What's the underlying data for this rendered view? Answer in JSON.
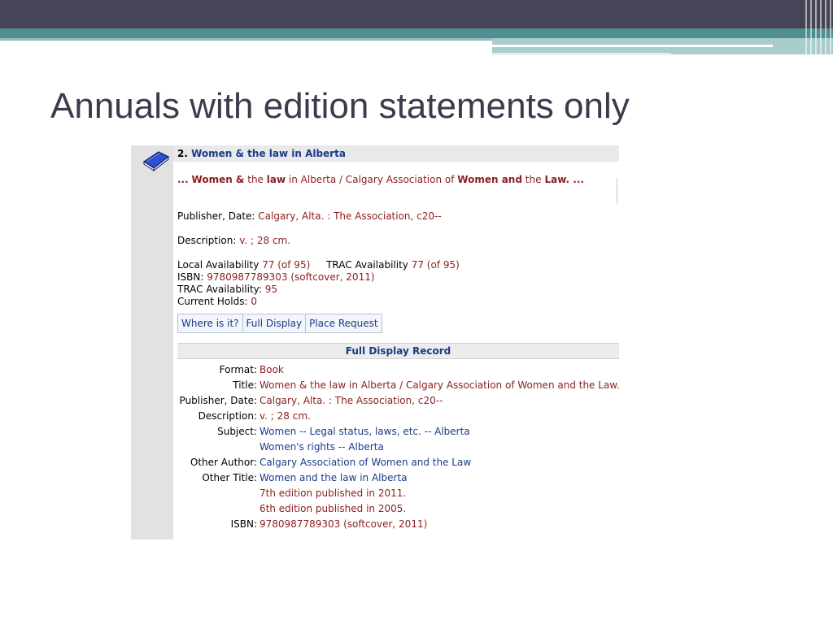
{
  "slide": {
    "title": "Annuals with edition statements only"
  },
  "record": {
    "number": "2.",
    "title": "Women & the law in Alberta",
    "summary": {
      "ellipsis1": "...",
      "w1": "Women &",
      "w2": "the",
      "w3": "law",
      "w4": "in Alberta / Calgary Association of",
      "w5": "Women and",
      "w6": "the",
      "w7": "Law",
      "w8": ". ..."
    },
    "publisher_label": "Publisher, Date:",
    "publisher_value": "Calgary, Alta. : The Association, c20--",
    "description_label": "Description:",
    "description_value": "v. ; 28 cm.",
    "local_avail_label": "Local Availability",
    "local_avail_value": "77 (of 95)",
    "trac_avail_label": "TRAC Availability",
    "trac_avail_value": "77 (of 95)",
    "isbn_label": "ISBN:",
    "isbn_value": "9780987789303 (softcover, 2011)",
    "trac_avail2_label": "TRAC Availability:",
    "trac_avail2_value": "95",
    "holds_label": "Current Holds:",
    "holds_value": "0"
  },
  "buttons": {
    "where": "Where is it?",
    "full": "Full Display",
    "place": "Place Request"
  },
  "full_display": {
    "header": "Full Display Record",
    "format_label": "Format:",
    "format_value": "Book",
    "title_label": "Title:",
    "title_value": "Women & the law in Alberta / Calgary Association of Women and the Law.",
    "publisher_label": "Publisher, Date:",
    "publisher_value": "Calgary, Alta. : The Association, c20--",
    "description_label": "Description:",
    "description_value": "v. ; 28 cm.",
    "subject_label": "Subject:",
    "subject_value1": "Women -- Legal status, laws, etc. -- Alberta",
    "subject_value2": "Women's rights -- Alberta",
    "other_author_label": "Other Author:",
    "other_author_value": "Calgary Association of Women and the Law",
    "other_title_label": "Other Title:",
    "other_title_value": "Women and the law in Alberta",
    "note1": "7th edition published in 2011.",
    "note2": "6th edition published in 2005.",
    "isbn_label": "ISBN:",
    "isbn_value": "9780987789303 (softcover, 2011)"
  },
  "colors": {
    "header_band": "#464457",
    "teal_band": "#4f8f8f",
    "link_blue": "#1a3a8a",
    "value_red": "#8b1e1e"
  }
}
